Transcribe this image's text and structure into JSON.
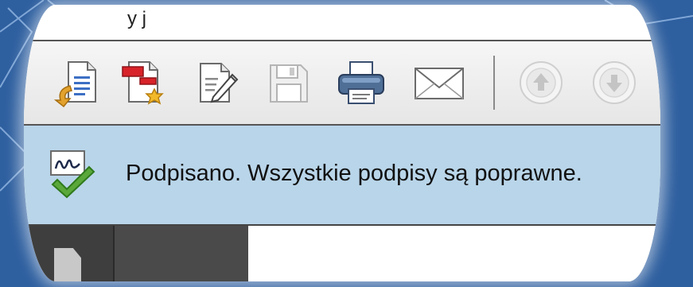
{
  "menubar": {
    "partial_text": "y j"
  },
  "toolbar": {
    "buttons": [
      {
        "name": "open-document",
        "icon": "document-open-arrow-icon"
      },
      {
        "name": "create-document",
        "icon": "document-red-star-icon"
      },
      {
        "name": "edit-document",
        "icon": "document-pencil-icon"
      },
      {
        "name": "save",
        "icon": "floppy-disk-icon"
      },
      {
        "name": "print",
        "icon": "printer-icon"
      },
      {
        "name": "email",
        "icon": "envelope-icon"
      },
      {
        "name": "previous-page",
        "icon": "arrow-up-icon"
      },
      {
        "name": "next-page",
        "icon": "arrow-down-icon"
      }
    ]
  },
  "signature_bar": {
    "icon": "signature-valid-check-icon",
    "message": "Podpisano. Wszystkie podpisy są poprawne."
  },
  "colors": {
    "background": "#2e5f9f",
    "infobar": "#b9d5e9",
    "check_green": "#5aa83a"
  }
}
